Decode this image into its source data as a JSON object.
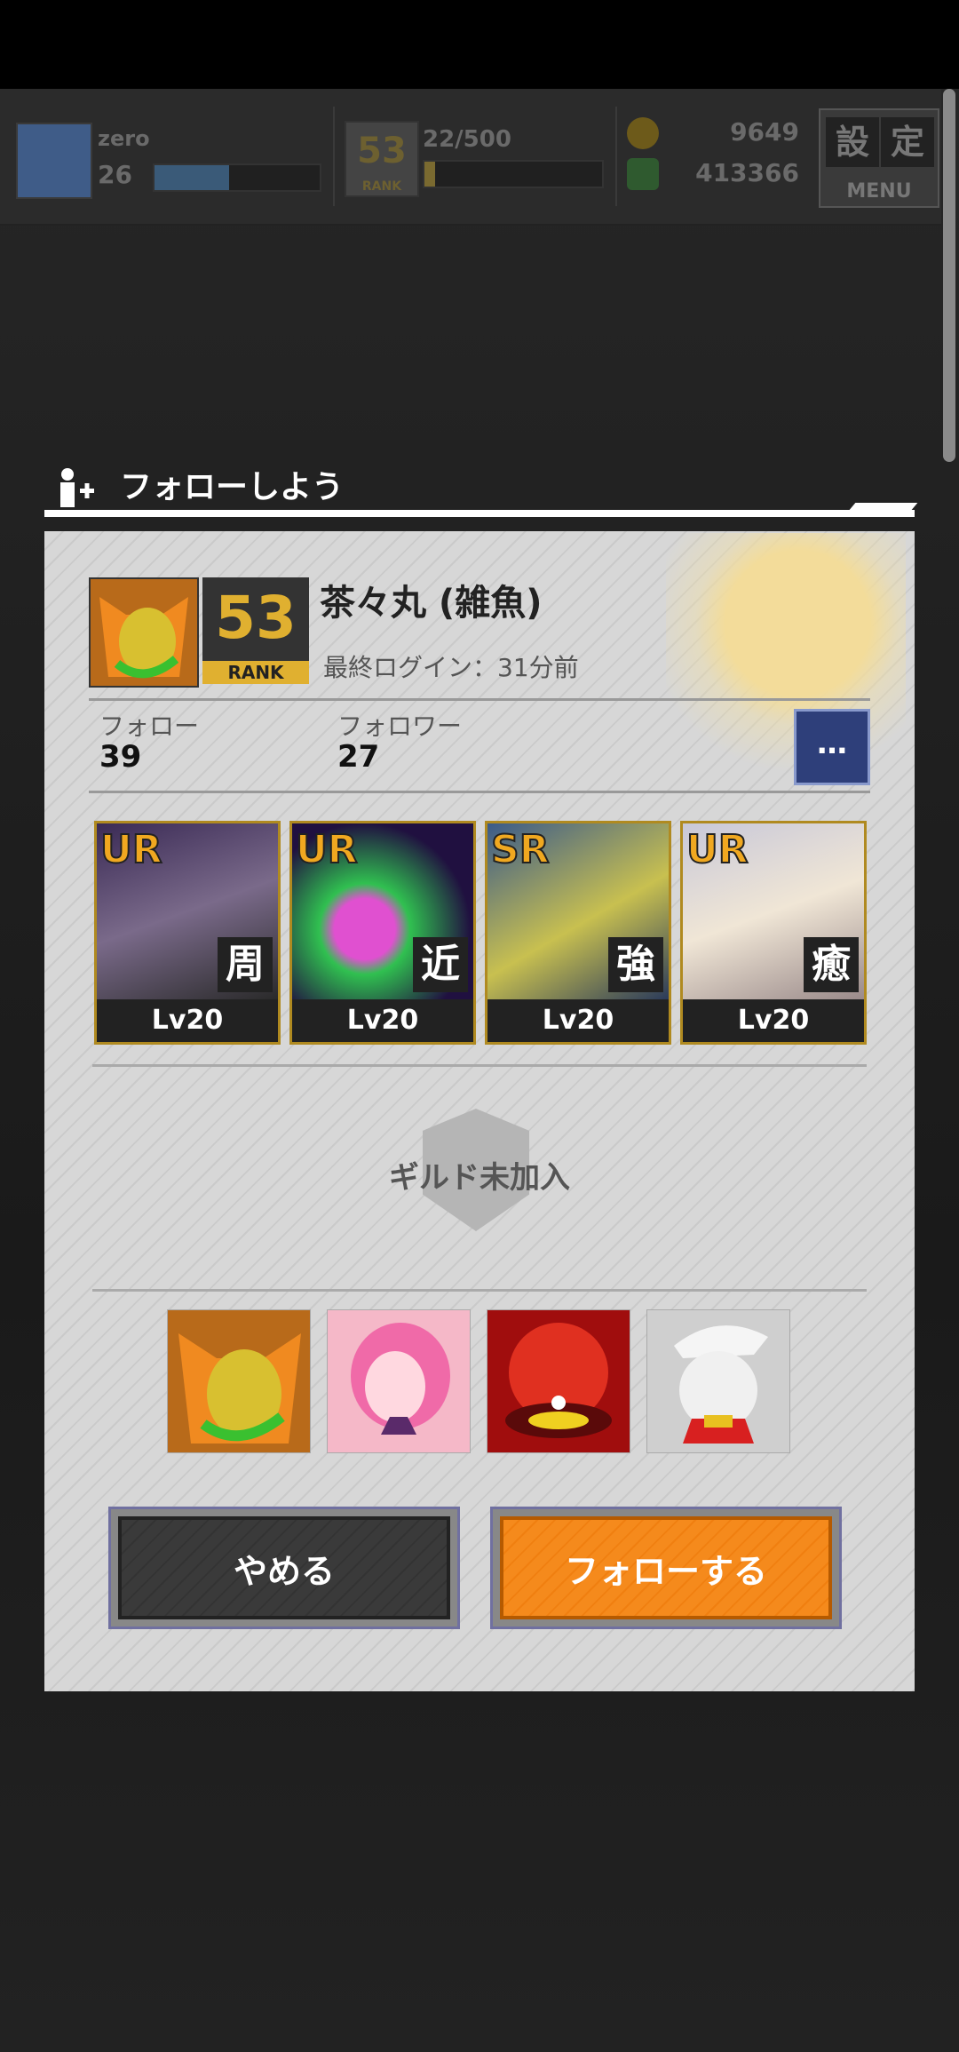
{
  "hud": {
    "player_name": "zero",
    "player_level": "26",
    "player_rank": "53",
    "rank_label": "RANK",
    "stamina": "22/500",
    "currency_gold": "9649",
    "currency_green": "413366",
    "menu_kanji_1": "設",
    "menu_kanji_2": "定",
    "menu_label": "MENU"
  },
  "dialog": {
    "title": "フォローしよう",
    "player": {
      "name": "茶々丸 (雑魚)",
      "rank": "53",
      "rank_label": "RANK",
      "last_login": "最終ログイン：31分前"
    },
    "stats": {
      "follow_label": "フォロー",
      "follow_count": "39",
      "follower_label": "フォロワー",
      "follower_count": "27"
    },
    "more_label": "…",
    "cards": [
      {
        "rarity": "UR",
        "type": "周",
        "level": "Lv20"
      },
      {
        "rarity": "UR",
        "type": "近",
        "level": "Lv20"
      },
      {
        "rarity": "SR",
        "type": "強",
        "level": "Lv20"
      },
      {
        "rarity": "UR",
        "type": "癒",
        "level": "Lv20"
      }
    ],
    "guild_status": "ギルド未加入",
    "buttons": {
      "cancel": "やめる",
      "follow": "フォローする"
    }
  },
  "colors": {
    "accent_orange": "#f58a1c",
    "rank_gold": "#e0b030",
    "more_button": "#2e3f7a"
  }
}
